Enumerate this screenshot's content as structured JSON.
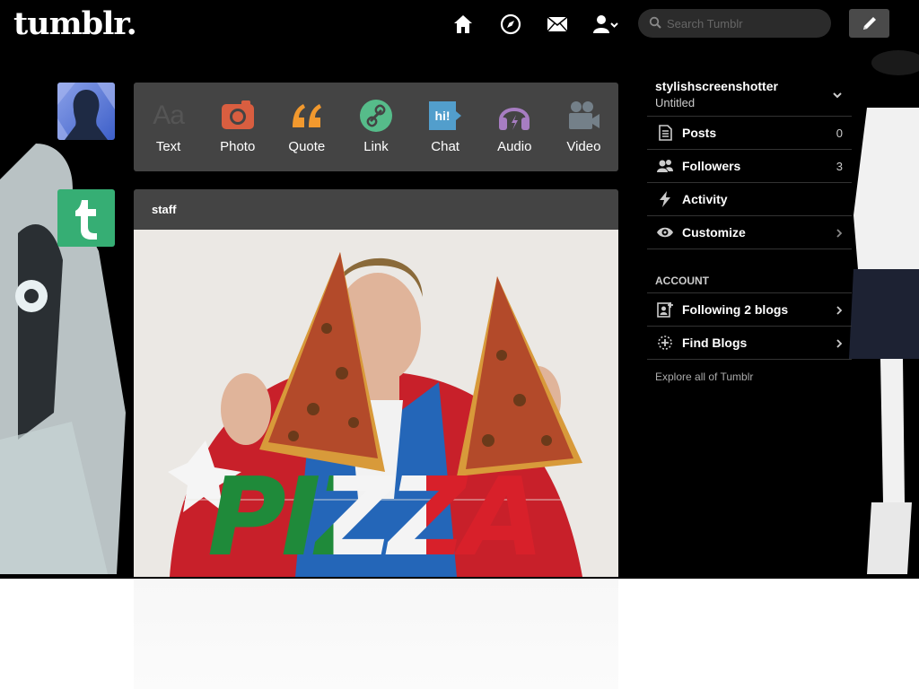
{
  "header": {
    "logo": "tumblr.",
    "search_placeholder": "Search Tumblr",
    "nav": [
      {
        "name": "home-icon"
      },
      {
        "name": "explore-compass-icon"
      },
      {
        "name": "inbox-mail-icon"
      },
      {
        "name": "account-user-icon"
      }
    ],
    "compose_icon": "pencil-icon"
  },
  "post_types": [
    {
      "label": "Text",
      "icon": "text-aa-icon",
      "color": "#555555"
    },
    {
      "label": "Photo",
      "icon": "camera-icon",
      "color": "#d95e40"
    },
    {
      "label": "Quote",
      "icon": "quote-icon",
      "color": "#f2992e"
    },
    {
      "label": "Link",
      "icon": "link-icon",
      "color": "#56bc8a"
    },
    {
      "label": "Chat",
      "icon": "chat-bubble-icon",
      "color": "#529ecc"
    },
    {
      "label": "Audio",
      "icon": "headphones-icon",
      "color": "#a77dc2"
    },
    {
      "label": "Video",
      "icon": "video-camera-icon",
      "color": "#748089"
    }
  ],
  "post": {
    "author": "staff",
    "image_text": "PIZZA"
  },
  "sidebar": {
    "blog_name": "stylishscreenshotter",
    "blog_subtitle": "Untitled",
    "items": [
      {
        "label": "Posts",
        "count": "0",
        "icon": "posts-icon"
      },
      {
        "label": "Followers",
        "count": "3",
        "icon": "followers-icon"
      },
      {
        "label": "Activity",
        "count": "",
        "icon": "activity-bolt-icon"
      },
      {
        "label": "Customize",
        "count": "",
        "icon": "customize-eye-icon"
      }
    ],
    "account_title": "ACCOUNT",
    "account_items": [
      {
        "label": "Following 2 blogs",
        "icon": "following-icon"
      },
      {
        "label": "Find Blogs",
        "icon": "find-blogs-icon"
      }
    ],
    "explore_link": "Explore all of Tumblr"
  },
  "colors": {
    "background": "#000000",
    "panel": "#444444",
    "tumblr_green": "#36ae74"
  }
}
